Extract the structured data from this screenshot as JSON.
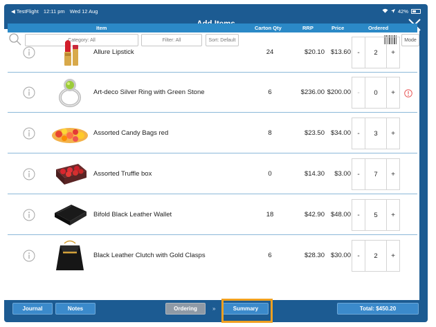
{
  "status": {
    "app": "◀ TestFlight",
    "time": "12:11 pm",
    "date": "Wed 12 Aug",
    "battery": "42%"
  },
  "titlebar": {
    "title": "Add Items"
  },
  "filters": {
    "category": "Category: All",
    "filter": "Filter: All",
    "sort": "Sort: Default",
    "mode": "Mode"
  },
  "columns": {
    "item": "Item",
    "carton_qty": "Carton Qty",
    "rrp": "RRP",
    "price": "Price",
    "ordered": "Ordered"
  },
  "items": [
    {
      "name": "Allure Lipstick",
      "carton_qty": "24",
      "rrp": "$20.10",
      "price": "$13.60",
      "ordered": "2",
      "minus": "-",
      "plus": "+",
      "image": "lipstick",
      "warning": false
    },
    {
      "name": "Art-deco Silver Ring with Green Stone",
      "carton_qty": "6",
      "rrp": "$236.00",
      "price": "$200.00",
      "ordered": "0",
      "minus": "-",
      "plus": "+",
      "image": "ring",
      "warning": true
    },
    {
      "name": "Assorted Candy Bags red",
      "carton_qty": "8",
      "rrp": "$23.50",
      "price": "$34.00",
      "ordered": "3",
      "minus": "-",
      "plus": "+",
      "image": "candy",
      "warning": false
    },
    {
      "name": "Assorted Truffle box",
      "carton_qty": "0",
      "rrp": "$14.30",
      "price": "$3.00",
      "ordered": "7",
      "minus": "-",
      "plus": "+",
      "image": "truffle-box",
      "warning": false
    },
    {
      "name": "Bifold Black Leather Wallet",
      "carton_qty": "18",
      "rrp": "$42.90",
      "price": "$48.00",
      "ordered": "5",
      "minus": "-",
      "plus": "+",
      "image": "wallet",
      "warning": false
    },
    {
      "name": "Black Leather Clutch with Gold Clasps",
      "carton_qty": "6",
      "rrp": "$28.30",
      "price": "$30.00",
      "ordered": "2",
      "minus": "-",
      "plus": "+",
      "image": "clutch",
      "warning": false
    }
  ],
  "bottom": {
    "journal": "Journal",
    "notes": "Notes",
    "ordering": "Ordering",
    "chevrons": "»",
    "summary": "Summary",
    "total": "Total: $450.20"
  },
  "colors": {
    "bar": "#1c5b92",
    "header": "#2b89c7",
    "highlight": "#f0a020"
  }
}
